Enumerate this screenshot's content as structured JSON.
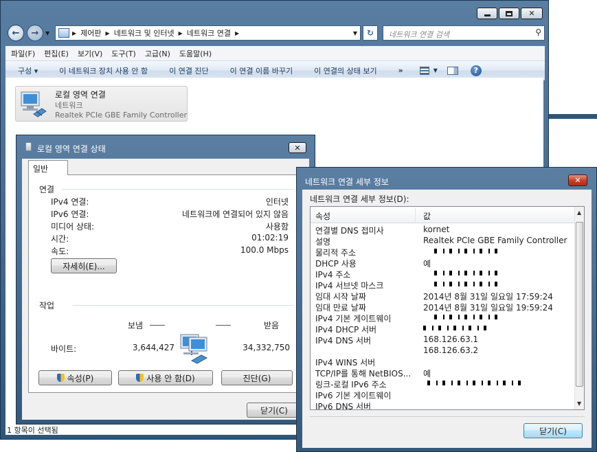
{
  "explorer": {
    "breadcrumb": [
      "제어판",
      "네트워크 및 인터넷",
      "네트워크 연결"
    ],
    "search_placeholder": "네트워크 연결 검색",
    "menu": [
      "파일(F)",
      "편집(E)",
      "보기(V)",
      "도구(T)",
      "고급(N)",
      "도움말(H)"
    ],
    "commands": [
      "구성 ▾",
      "이 네트워크 장치 사용 안 함",
      "이 연결 진단",
      "이 연결 이름 바꾸기",
      "이 연결의 상태 보기"
    ],
    "more": "»",
    "connection": {
      "name": "로컬 영역 연결",
      "status": "네트워크",
      "adapter": "Realtek PCIe GBE Family Controller"
    },
    "statusbar": "1 항목이 선택됨"
  },
  "status_dialog": {
    "title": "로컬 영역 연결 상태",
    "tab": "일반",
    "connection_group": "연결",
    "rows": [
      {
        "label": "IPv4 연결:",
        "value": "인터넷"
      },
      {
        "label": "IPv6 연결:",
        "value": "네트워크에 연결되어 있지 않음"
      },
      {
        "label": "미디어 상태:",
        "value": "사용함"
      },
      {
        "label": "시간:",
        "value": "01:02:19"
      },
      {
        "label": "속도:",
        "value": "100.0 Mbps"
      }
    ],
    "details_button": "자세히(E)...",
    "activity_group": "작업",
    "sent_label": "보냄",
    "received_label": "받음",
    "bytes_label": "바이트:",
    "bytes_sent": "3,644,427",
    "bytes_received": "34,332,750",
    "properties_button": "속성(P)",
    "disable_button": "사용 안 함(D)",
    "diagnose_button": "진단(G)",
    "close_button": "닫기(C)"
  },
  "details_dialog": {
    "title": "네트워크 연결 세부 정보",
    "caption": "네트워크 연결 세부 정보(D):",
    "col_property": "속성",
    "col_value": "값",
    "rows": [
      {
        "p": "연결별 DNS 접미사",
        "v": "kornet"
      },
      {
        "p": "설명",
        "v": "Realtek PCIe GBE Family Controller"
      },
      {
        "p": "물리적 주소",
        "v": ""
      },
      {
        "p": "DHCP 사용",
        "v": "예"
      },
      {
        "p": "IPv4 주소",
        "v": ""
      },
      {
        "p": "IPv4 서브넷 마스크",
        "v": ""
      },
      {
        "p": "임대 시작 날짜",
        "v": "2014년 8월 31일 일요일 17:59:24"
      },
      {
        "p": "임대 만료 날짜",
        "v": "2014년 8월 31일 일요일 19:59:24"
      },
      {
        "p": "IPv4 기본 게이트웨이",
        "v": ""
      },
      {
        "p": "IPv4 DHCP 서버",
        "v": ""
      },
      {
        "p": "IPv4 DNS 서버",
        "v": "168.126.63.1"
      },
      {
        "p": "",
        "v": "168.126.63.2"
      },
      {
        "p": "IPv4 WINS 서버",
        "v": ""
      },
      {
        "p": "TCP/IP를 통해 NetBIOS...",
        "v": "예"
      },
      {
        "p": "링크-로컬 IPv6 주소",
        "v": ""
      },
      {
        "p": "IPv6 기본 게이트웨이",
        "v": ""
      },
      {
        "p": "IPv6 DNS 서버",
        "v": ""
      }
    ],
    "close_button": "닫기(C)"
  }
}
